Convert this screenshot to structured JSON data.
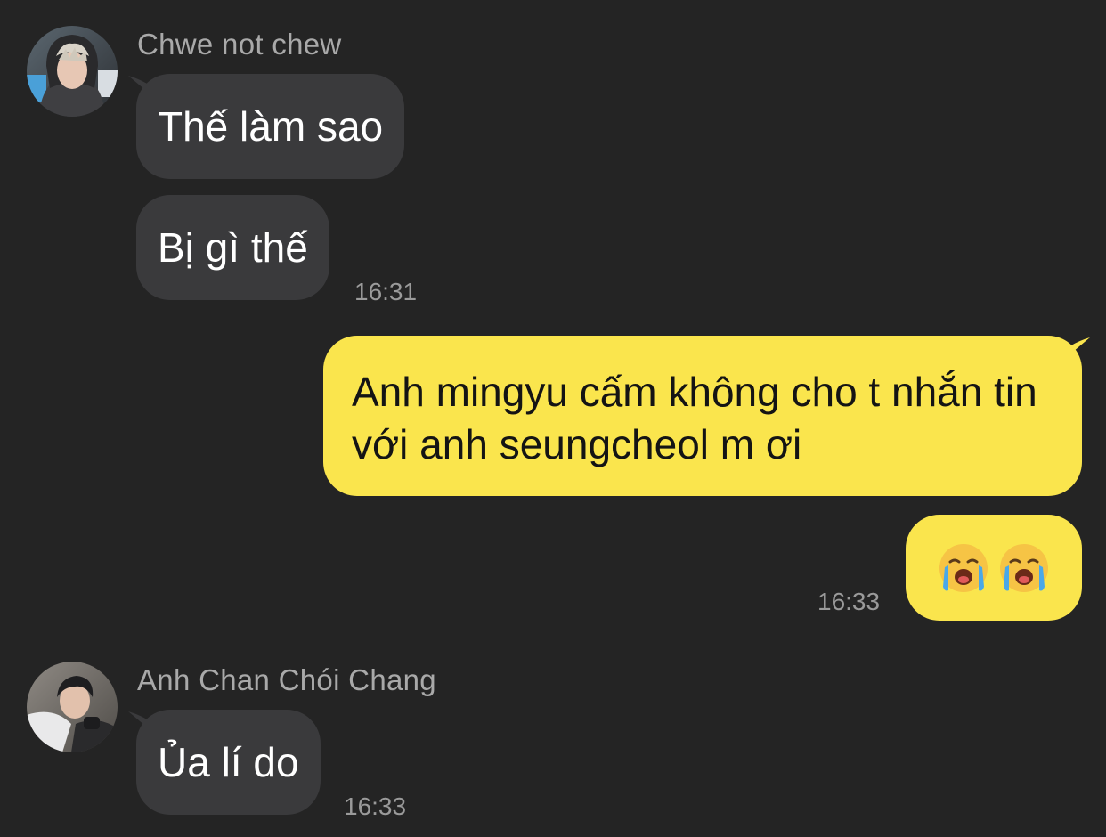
{
  "conversation": {
    "messages_block_1": {
      "sender_name": "Chwe not chew",
      "msg1": "Thế làm sao",
      "msg2": "Bị gì thế",
      "time": "16:31"
    },
    "my_block": {
      "msg1": "Anh mingyu cấm không cho t nhắn tin với anh seungcheol m ơi",
      "msg2_emojis": [
        "loudly-crying-face",
        "loudly-crying-face"
      ],
      "time": "16:33"
    },
    "messages_block_2": {
      "sender_name": "Anh Chan Chói Chang",
      "msg1": "Ủa lí do",
      "time": "16:33"
    }
  },
  "colors": {
    "background": "#242424",
    "incoming_bubble": "#3a3a3c",
    "outgoing_bubble": "#fae54d",
    "sender_text": "#a9a9a9",
    "timestamp_text": "#9a9a9a"
  }
}
